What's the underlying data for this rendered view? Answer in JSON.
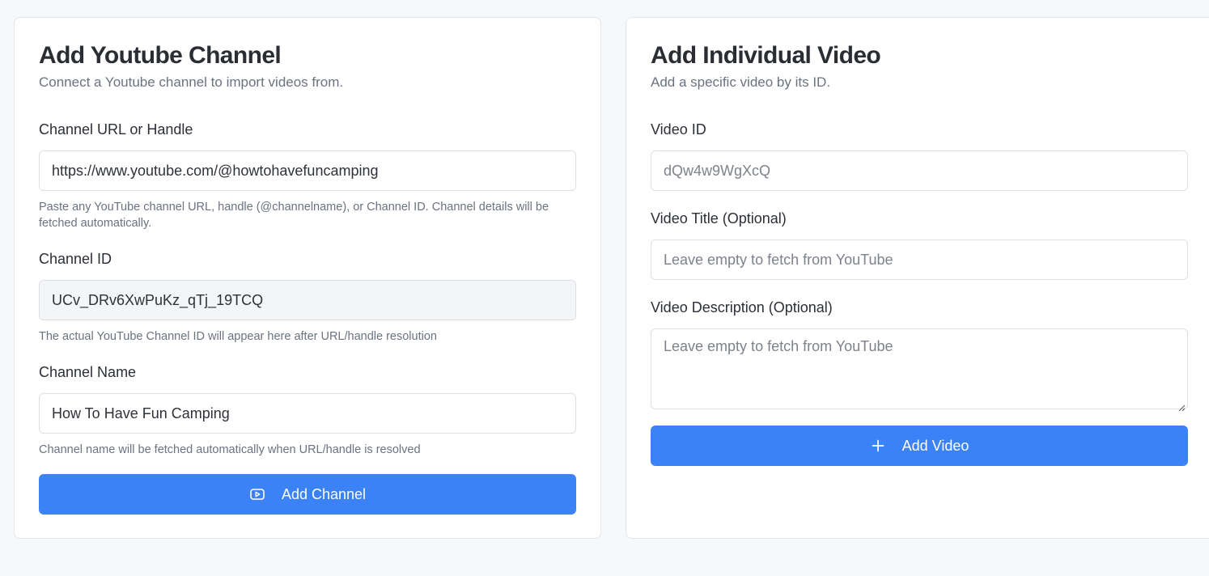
{
  "channel_form": {
    "title": "Add Youtube Channel",
    "subtitle": "Connect a Youtube channel to import videos from.",
    "url_label": "Channel URL or Handle",
    "url_value": "https://www.youtube.com/@howtohavefuncamping",
    "url_help": "Paste any YouTube channel URL, handle (@channelname), or Channel ID. Channel details will be fetched automatically.",
    "id_label": "Channel ID",
    "id_value": "UCv_DRv6XwPuKz_qTj_19TCQ",
    "id_help": "The actual YouTube Channel ID will appear here after URL/handle resolution",
    "name_label": "Channel Name",
    "name_value": "How To Have Fun Camping",
    "name_help": "Channel name will be fetched automatically when URL/handle is resolved",
    "submit_label": "Add Channel",
    "submit_icon": "youtube-play-icon"
  },
  "video_form": {
    "title": "Add Individual Video",
    "subtitle": "Add a specific video by its ID.",
    "id_label": "Video ID",
    "id_placeholder": "dQw4w9WgXcQ",
    "title_label": "Video Title (Optional)",
    "title_placeholder": "Leave empty to fetch from YouTube",
    "description_label": "Video Description (Optional)",
    "description_placeholder": "Leave empty to fetch from YouTube",
    "submit_label": "Add Video",
    "submit_icon": "plus-icon"
  },
  "colors": {
    "accent": "#3b82f6",
    "background": "#f7f8fa",
    "card": "#ffffff"
  }
}
